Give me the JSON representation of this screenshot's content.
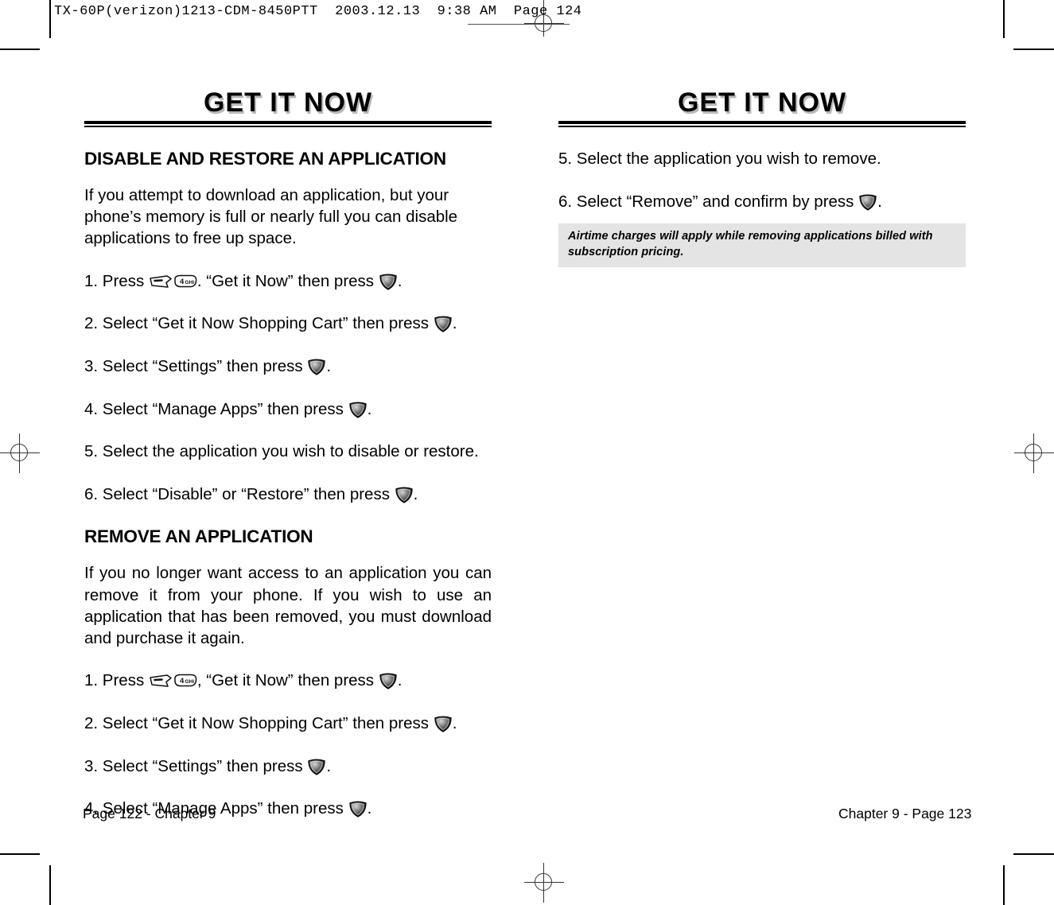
{
  "film_header": {
    "text": "TX-60P(verizon)1213-CDM-8450PTT  2003.12.13  9:38 AM  Page 124"
  },
  "left_page": {
    "title": "GET IT NOW",
    "sections": [
      {
        "heading": "DISABLE AND RESTORE AN APPLICATION",
        "intro": "If you attempt to download an application, but your phone’s memory is full or nearly full you can disable applications to free up space.",
        "steps": [
          {
            "before": "1. Press ",
            "icons": [
              "softkey-icon",
              "key-4-ghi-icon"
            ],
            "middle": ". “Get it Now” then press ",
            "icon_end": "ok-key-icon",
            "after": "."
          },
          {
            "before": "2. Select “Get it Now Shopping Cart” then press ",
            "icon_end": "ok-key-icon",
            "after": "."
          },
          {
            "before": "3. Select “Settings” then press ",
            "icon_end": "ok-key-icon",
            "after": "."
          },
          {
            "before": "4. Select “Manage Apps” then press ",
            "icon_end": "ok-key-icon",
            "after": "."
          },
          {
            "before": "5. Select the application you wish to disable or restore.",
            "icon_end": null,
            "after": ""
          },
          {
            "before": "6. Select “Disable” or “Restore” then press ",
            "icon_end": "ok-key-icon",
            "after": "."
          }
        ]
      },
      {
        "heading": "REMOVE AN APPLICATION",
        "intro": "If you no longer want access to an application you can remove it from your phone. If you wish to use an application that has been removed, you must download and purchase it again.",
        "steps": [
          {
            "before": "1. Press ",
            "icons": [
              "softkey-icon",
              "key-4-ghi-icon"
            ],
            "middle": ", “Get it Now” then press ",
            "icon_end": "ok-key-icon",
            "after": "."
          },
          {
            "before": "2. Select “Get it Now Shopping Cart” then press ",
            "icon_end": "ok-key-icon",
            "after": "."
          },
          {
            "before": "3. Select “Settings” then press ",
            "icon_end": "ok-key-icon",
            "after": "."
          },
          {
            "before": "4. Select “Manage Apps” then press ",
            "icon_end": "ok-key-icon",
            "after": "."
          }
        ]
      }
    ],
    "footer": "Page 122 - Chapter 9"
  },
  "right_page": {
    "title": "GET IT NOW",
    "steps": [
      {
        "before": "5. Select the application you wish to remove.",
        "icon_end": null,
        "after": ""
      },
      {
        "before": "6. Select “Remove” and confirm by press ",
        "icon_end": "ok-key-icon",
        "after": "."
      }
    ],
    "note": {
      "line1": "Airtime charges will apply while removing applications billed with",
      "line2": "subscription pricing."
    },
    "footer": "Chapter 9 - Page 123"
  },
  "key_labels": {
    "key4_digit": "4",
    "key4_letters": "GHI"
  },
  "colors": {
    "text": "#000000",
    "note_background": "#e4e4e4",
    "title_shadow": "#b9b9b9",
    "mark": "#333333"
  }
}
